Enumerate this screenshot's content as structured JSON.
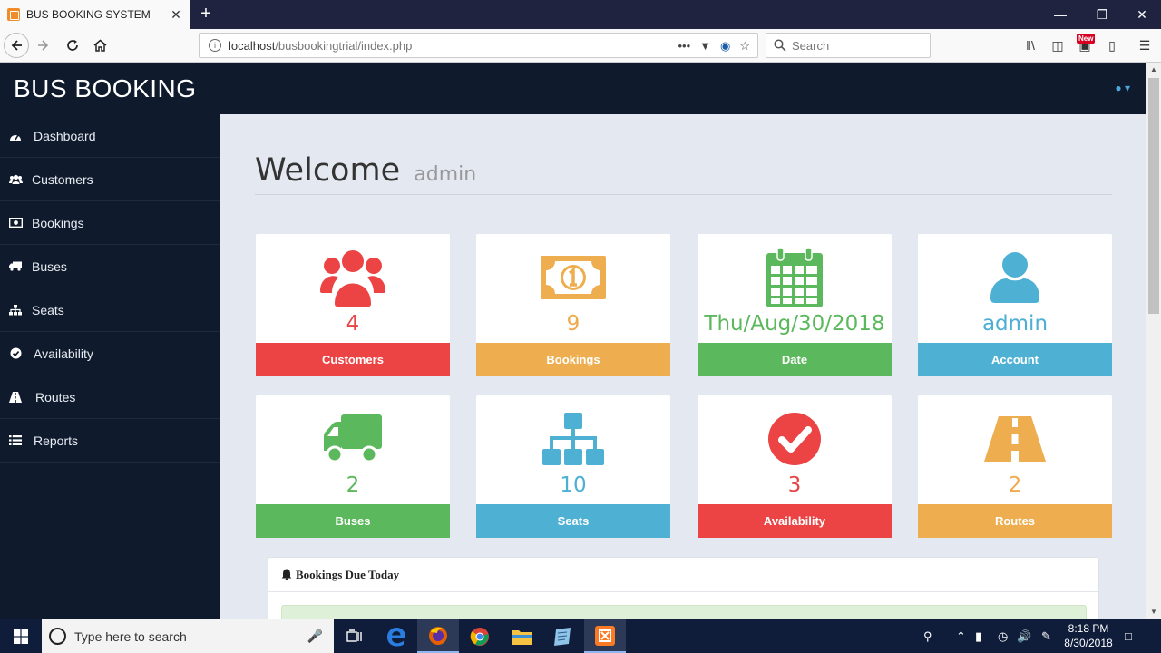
{
  "browser": {
    "tab_title": "BUS BOOKING SYSTEM",
    "tab_close": "✕",
    "new_tab": "+",
    "url_host": "localhost",
    "url_path": "/busbookingtrial/index.php",
    "search_placeholder": "Search",
    "new_badge": "New"
  },
  "app": {
    "brand": "BUS BOOKING"
  },
  "sidebar": {
    "items": [
      {
        "label": "Dashboard",
        "icon": "dashboard-icon"
      },
      {
        "label": "Customers",
        "icon": "users-icon"
      },
      {
        "label": "Bookings",
        "icon": "money-icon"
      },
      {
        "label": "Buses",
        "icon": "truck-icon"
      },
      {
        "label": "Seats",
        "icon": "sitemap-icon"
      },
      {
        "label": "Availability",
        "icon": "check-circle-icon"
      },
      {
        "label": "Routes",
        "icon": "road-icon"
      },
      {
        "label": "Reports",
        "icon": "list-icon"
      }
    ]
  },
  "main": {
    "welcome": "Welcome",
    "username": "admin",
    "cards": [
      {
        "value": "4",
        "label": "Customers",
        "color": "#ec4444",
        "icon": "users-icon"
      },
      {
        "value": "9",
        "label": "Bookings",
        "color": "#eeae4f",
        "icon": "money-icon"
      },
      {
        "value": "Thu/Aug/30/2018",
        "label": "Date",
        "color": "#5cb85c",
        "icon": "calendar-icon"
      },
      {
        "value": "admin",
        "label": "Account",
        "color": "#4eb1d4",
        "icon": "user-icon"
      },
      {
        "value": "2",
        "label": "Buses",
        "color": "#5cb85c",
        "icon": "truck-icon"
      },
      {
        "value": "10",
        "label": "Seats",
        "color": "#4eb1d4",
        "icon": "sitemap-icon"
      },
      {
        "value": "3",
        "label": "Availability",
        "color": "#ec4444",
        "icon": "check-circle-icon"
      },
      {
        "value": "2",
        "label": "Routes",
        "color": "#eeae4f",
        "icon": "road-icon"
      }
    ],
    "panel_title": "Bookings Due Today"
  },
  "taskbar": {
    "search_placeholder": "Type here to search",
    "time": "8:18 PM",
    "date": "8/30/2018"
  }
}
